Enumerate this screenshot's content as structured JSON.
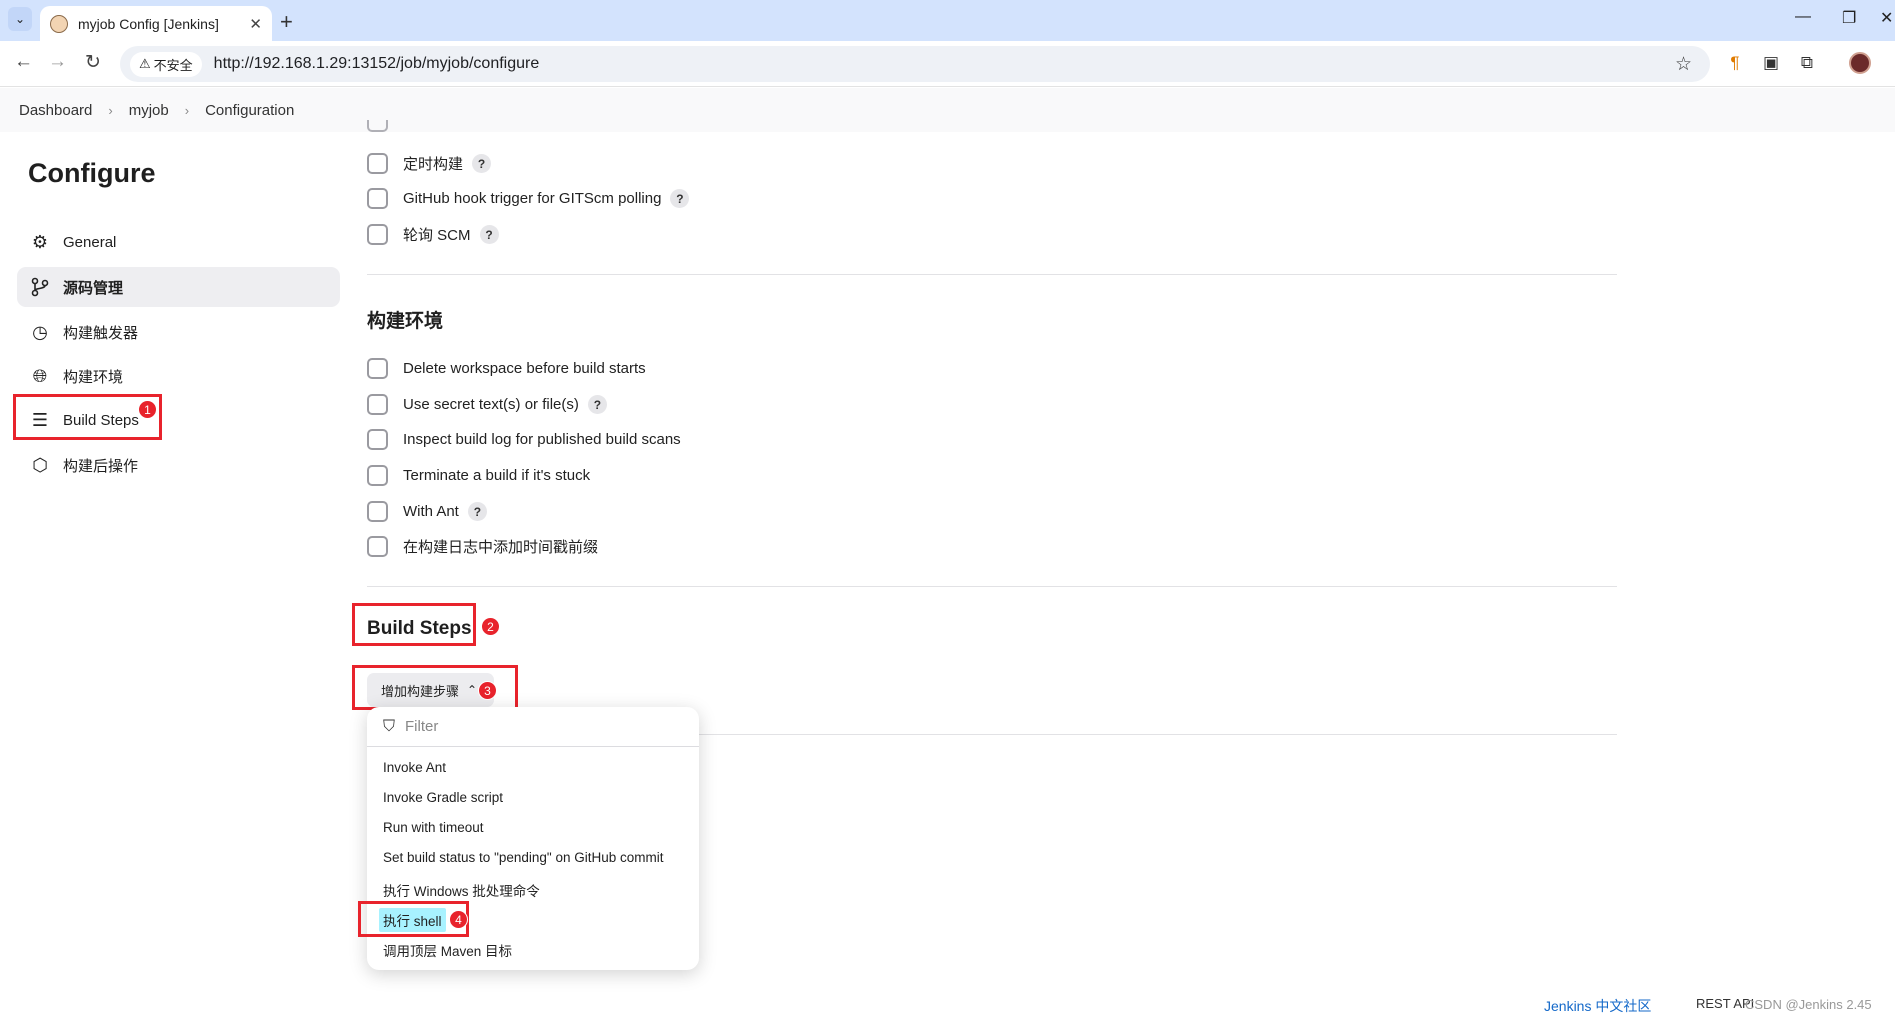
{
  "browser": {
    "tab_title": "myjob Config [Jenkins]",
    "tab_close": "✕",
    "new_tab": "+",
    "security_label": "不安全",
    "url": "http://192.168.1.29:13152/job/myjob/configure",
    "win_minimize": "—",
    "win_restore": "❐",
    "win_close": "✕"
  },
  "breadcrumb": {
    "items": [
      "Dashboard",
      "myjob",
      "Configuration"
    ],
    "separator": "›"
  },
  "sidebar": {
    "title": "Configure",
    "items": [
      {
        "label": "General",
        "icon": "gear-icon"
      },
      {
        "label": "源码管理",
        "icon": "branch-icon"
      },
      {
        "label": "构建触发器",
        "icon": "clock-icon"
      },
      {
        "label": "构建环境",
        "icon": "globe-icon"
      },
      {
        "label": "Build Steps",
        "icon": "list-icon"
      },
      {
        "label": "构建后操作",
        "icon": "package-icon"
      }
    ],
    "active_index": 1
  },
  "triggers": {
    "items": [
      {
        "label": "定时构建",
        "help": "?"
      },
      {
        "label": "GitHub hook trigger for GITScm polling",
        "help": "?"
      },
      {
        "label": "轮询 SCM",
        "help": "?"
      }
    ]
  },
  "build_env": {
    "title": "构建环境",
    "items": [
      {
        "label": "Delete workspace before build starts",
        "help": ""
      },
      {
        "label": "Use secret text(s) or file(s)",
        "help": "?"
      },
      {
        "label": "Inspect build log for published build scans",
        "help": ""
      },
      {
        "label": "Terminate a build if it's stuck",
        "help": ""
      },
      {
        "label": "With Ant",
        "help": "?"
      },
      {
        "label": "在构建日志中添加时间戳前缀",
        "help": ""
      }
    ]
  },
  "build_steps": {
    "title": "Build Steps",
    "add_button": "增加构建步骤",
    "filter_placeholder": "Filter",
    "menu": [
      "Invoke Ant",
      "Invoke Gradle script",
      "Run with timeout",
      "Set build status to \"pending\" on GitHub commit",
      "执行 Windows 批处理命令",
      "执行 shell",
      "调用顶层 Maven 目标"
    ],
    "highlighted_index": 5
  },
  "annotations": [
    "1",
    "2",
    "3",
    "4"
  ],
  "footer": {
    "community": "Jenkins 中文社区",
    "rest_api": "REST API",
    "watermark": "CSDN @Jenkins 2.45"
  },
  "colors": {
    "annotation_red": "#e8232c",
    "highlight": "#a8f2ff",
    "link_blue": "#1469c9"
  }
}
